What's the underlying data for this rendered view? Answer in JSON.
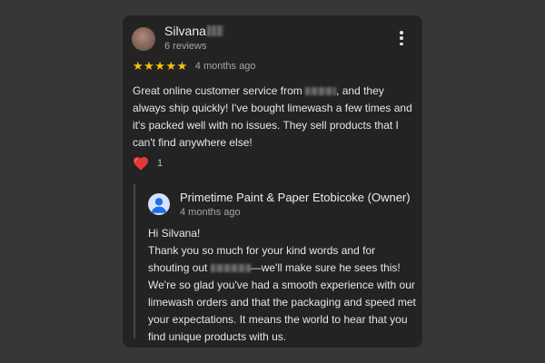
{
  "review": {
    "reviewer_name": "Silvana",
    "review_count": "6 reviews",
    "rating": 5,
    "stars": "★★★★★",
    "time": "4 months ago",
    "text_part1": "Great online customer service from ",
    "text_part2": ", and they always ship quickly! I've bought limewash a few times and it's packed well with no issues. They sell products that I can't find anywhere else!",
    "reaction_icon": "heart-icon",
    "reaction_count": "1"
  },
  "owner_reply": {
    "owner_name": "Primetime Paint & Paper Etobicoke (Owner)",
    "time": "4 months ago",
    "greeting": "Hi Silvana!",
    "body_part1": "Thank you so much for your kind words and for shouting out ",
    "body_part2": "—we'll make sure he sees this! We're so glad you've had a smooth experience with our limewash orders and that the packaging and speed met your expectations. It means the world to hear that you find unique products with us."
  },
  "colors": {
    "page_background": "#373737",
    "card_background": "#232323",
    "star": "#f7c10c",
    "heart": "#e53935",
    "owner_avatar_bg": "#d7e3fc",
    "owner_avatar_fg": "#1a73e8"
  }
}
